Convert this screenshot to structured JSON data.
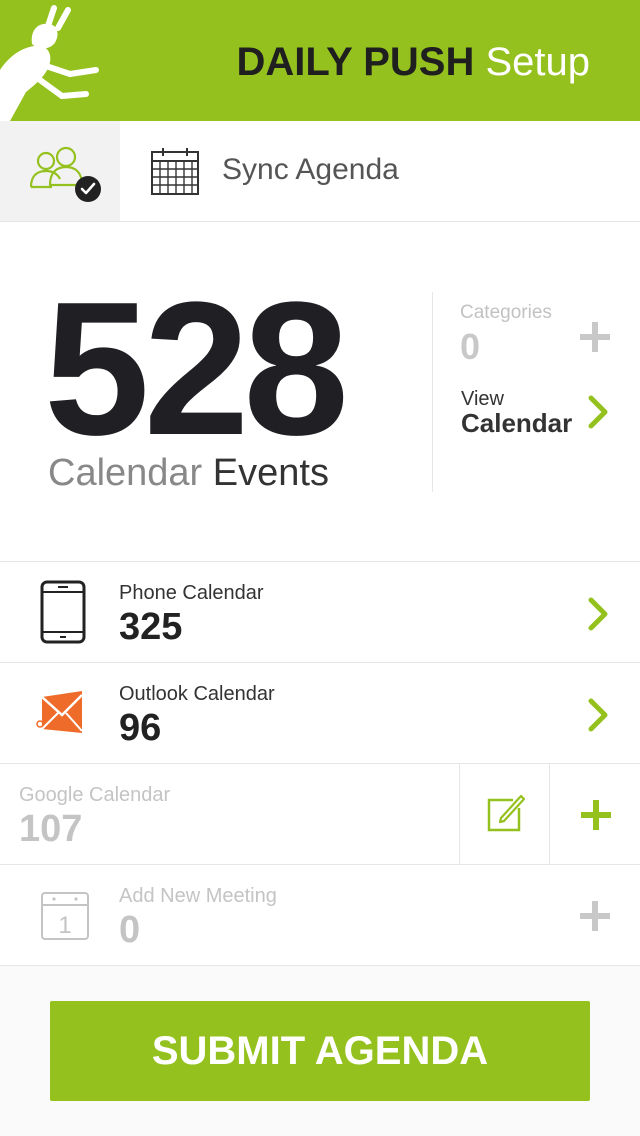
{
  "header": {
    "title_bold": "DAILY PUSH",
    "title_light": "Setup"
  },
  "tabs": {
    "sync_label": "Sync Agenda"
  },
  "summary": {
    "total_events": "528",
    "caption_light": "Calendar",
    "caption_dark": "Events",
    "categories_label": "Categories",
    "categories_value": "0",
    "view_label": "View",
    "view_value": "Calendar"
  },
  "calendars": [
    {
      "label": "Phone Calendar",
      "value": "325"
    },
    {
      "label": "Outlook Calendar",
      "value": "96"
    },
    {
      "label": "Google Calendar",
      "value": "107"
    },
    {
      "label": "Add New Meeting",
      "value": "0"
    }
  ],
  "footer": {
    "submit_label": "SUBMIT AGENDA"
  },
  "colors": {
    "accent": "#95c11f",
    "outlook": "#ef6b2a",
    "disabled": "#c4c4c4"
  }
}
